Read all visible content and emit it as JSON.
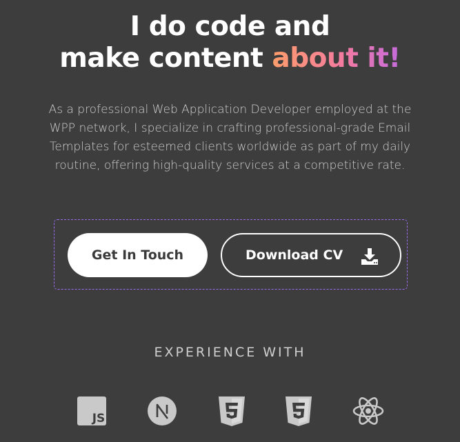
{
  "hero": {
    "line1": "I do code and",
    "line2_prefix": "make content ",
    "line2_accent": "about it!"
  },
  "description": "As a professional Web Application Developer employed at the WPP network,  I specialize in crafting professional-grade Email Templates  for esteemed clients worldwide as part of my daily routine, offering high-quality services at a competitive rate.",
  "buttons": {
    "get_in_touch": "Get In Touch",
    "download_cv": "Download CV",
    "download_icon": "download-icon"
  },
  "experience": {
    "heading": "EXPERIENCE WITH",
    "icons": [
      "javascript-icon",
      "nextjs-icon",
      "html5-icon",
      "css3-icon",
      "react-icon"
    ]
  },
  "colors": {
    "background": "#3d3d3d",
    "accent_start": "#ff9d6b",
    "accent_end": "#c56bdc",
    "dashed_border": "#9b6cf0",
    "icon_gray": "#c9c9c9"
  }
}
